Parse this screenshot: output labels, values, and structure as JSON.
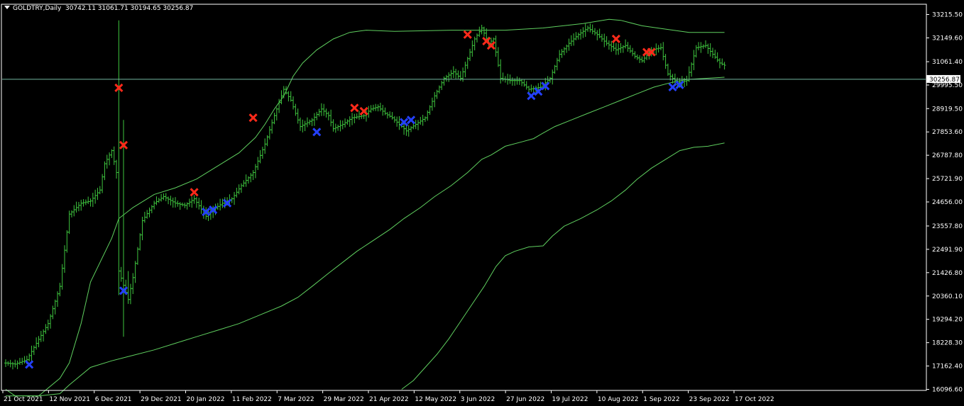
{
  "header": {
    "symbol": "GOLDTRY,Daily",
    "ohlc": "30742.11 31061.71 30194.65 30256.87"
  },
  "colors": {
    "background": "#000000",
    "frame": "#ffffff",
    "bars": "#3ec43e",
    "bands": "#5fcf5f",
    "price_line": "#74b8a0",
    "sell_marker": "#ff2a1a",
    "buy_marker": "#2440ff",
    "price_label_bg": "#ffffff"
  },
  "chart_data": {
    "type": "line",
    "chart_kind": "OHLC bar chart with bands and signal markers",
    "symbol": "GOLDTRY",
    "timeframe": "Daily",
    "current_price": "30256.87",
    "ylim": [
      16096.6,
      33647
    ],
    "y_ticks": [
      "33215.50",
      "32149.60",
      "31061.40",
      "29995.50",
      "28919.50",
      "27853.60",
      "26787.80",
      "25721.90",
      "24656.00",
      "23557.80",
      "22491.90",
      "21426.80",
      "20360.10",
      "19294.20",
      "18228.30",
      "17162.40",
      "16096.60"
    ],
    "x_ticks": [
      "21 Oct 2021",
      "12 Nov 2021",
      "6 Dec 2021",
      "29 Dec 2021",
      "20 Jan 2022",
      "11 Feb 2022",
      "7 Mar 2022",
      "29 Mar 2022",
      "21 Apr 2022",
      "12 May 2022",
      "3 Jun 2022",
      "27 Jun 2022",
      "19 Jul 2022",
      "10 Aug 2022",
      "1 Sep 2022",
      "23 Sep 2022",
      "17 Oct 2022"
    ],
    "close_series": [
      [
        0,
        17300
      ],
      [
        4,
        17250
      ],
      [
        9,
        17450
      ],
      [
        13,
        18200
      ],
      [
        18,
        19100
      ],
      [
        23,
        20800
      ],
      [
        27,
        24100
      ],
      [
        32,
        24600
      ],
      [
        36,
        24700
      ],
      [
        40,
        25200
      ],
      [
        42,
        26400
      ],
      [
        45,
        27000
      ],
      [
        47,
        26000
      ],
      [
        48,
        21500
      ],
      [
        52,
        20200
      ],
      [
        54,
        21200
      ],
      [
        58,
        23800
      ],
      [
        63,
        24600
      ],
      [
        67,
        24900
      ],
      [
        72,
        24600
      ],
      [
        76,
        24500
      ],
      [
        80,
        24800
      ],
      [
        85,
        24000
      ],
      [
        88,
        24300
      ],
      [
        92,
        24600
      ],
      [
        96,
        24800
      ],
      [
        100,
        25400
      ],
      [
        105,
        26000
      ],
      [
        110,
        27300
      ],
      [
        114,
        28600
      ],
      [
        118,
        29800
      ],
      [
        121,
        29300
      ],
      [
        125,
        28100
      ],
      [
        130,
        28400
      ],
      [
        134,
        28900
      ],
      [
        137,
        28600
      ],
      [
        139,
        28000
      ],
      [
        143,
        28200
      ],
      [
        147,
        28500
      ],
      [
        152,
        28600
      ],
      [
        155,
        28900
      ],
      [
        158,
        29000
      ],
      [
        161,
        28700
      ],
      [
        164,
        28500
      ],
      [
        167,
        28200
      ],
      [
        170,
        27900
      ],
      [
        174,
        28200
      ],
      [
        178,
        28500
      ],
      [
        182,
        29500
      ],
      [
        186,
        30300
      ],
      [
        190,
        30600
      ],
      [
        193,
        30300
      ],
      [
        196,
        31200
      ],
      [
        199,
        32100
      ],
      [
        202,
        32600
      ],
      [
        205,
        31900
      ],
      [
        207,
        32100
      ],
      [
        210,
        30300
      ],
      [
        214,
        30200
      ],
      [
        218,
        30200
      ],
      [
        222,
        29800
      ],
      [
        227,
        29900
      ],
      [
        231,
        30300
      ],
      [
        235,
        31400
      ],
      [
        239,
        31900
      ],
      [
        243,
        32300
      ],
      [
        247,
        32600
      ],
      [
        251,
        32300
      ],
      [
        255,
        31900
      ],
      [
        259,
        31600
      ],
      [
        263,
        31800
      ],
      [
        267,
        31300
      ],
      [
        270,
        31100
      ],
      [
        274,
        31600
      ],
      [
        278,
        31700
      ],
      [
        281,
        30500
      ],
      [
        285,
        30100
      ],
      [
        289,
        30200
      ],
      [
        293,
        31700
      ],
      [
        297,
        31800
      ],
      [
        300,
        31400
      ],
      [
        303,
        31000
      ],
      [
        305,
        30900
      ]
    ],
    "upper_band": [
      [
        0,
        16096.6
      ],
      [
        4,
        15800
      ],
      [
        14,
        15800
      ],
      [
        23,
        15900
      ],
      [
        27,
        16300
      ],
      [
        36,
        17100
      ],
      [
        45,
        17400
      ],
      [
        54,
        17650
      ],
      [
        63,
        17900
      ],
      [
        72,
        18200
      ],
      [
        81,
        18500
      ],
      [
        90,
        18800
      ],
      [
        99,
        19100
      ],
      [
        108,
        19500
      ],
      [
        117,
        19900
      ],
      [
        124,
        20300
      ],
      [
        130,
        20800
      ],
      [
        137,
        21400
      ],
      [
        143,
        21900
      ],
      [
        149,
        22400
      ],
      [
        156,
        22900
      ],
      [
        163,
        23400
      ],
      [
        169,
        23900
      ],
      [
        176,
        24400
      ],
      [
        182,
        24900
      ],
      [
        189,
        25400
      ],
      [
        196,
        26000
      ],
      [
        202,
        26600
      ],
      [
        206,
        26800
      ],
      [
        212,
        27200
      ],
      [
        219,
        27400
      ],
      [
        224,
        27550
      ],
      [
        228,
        27800
      ],
      [
        233,
        28100
      ],
      [
        240,
        28400
      ],
      [
        247,
        28700
      ],
      [
        254,
        29000
      ],
      [
        261,
        29300
      ],
      [
        268,
        29600
      ],
      [
        275,
        29900
      ],
      [
        282,
        30100
      ],
      [
        289,
        30250
      ],
      [
        305,
        30350
      ]
    ],
    "middle_band": [
      [
        0,
        15800
      ],
      [
        14,
        15800
      ],
      [
        23,
        16600
      ],
      [
        27,
        17300
      ],
      [
        32,
        19100
      ],
      [
        36,
        21000
      ],
      [
        45,
        23000
      ],
      [
        48,
        23900
      ],
      [
        54,
        24400
      ],
      [
        63,
        25000
      ],
      [
        72,
        25300
      ],
      [
        81,
        25700
      ],
      [
        90,
        26300
      ],
      [
        99,
        26900
      ],
      [
        106,
        27600
      ],
      [
        110,
        28200
      ],
      [
        114,
        28900
      ],
      [
        118,
        29500
      ],
      [
        122,
        30400
      ],
      [
        126,
        31000
      ],
      [
        132,
        31600
      ],
      [
        139,
        32100
      ],
      [
        146,
        32400
      ],
      [
        153,
        32500
      ],
      [
        165,
        32450
      ],
      [
        190,
        32500
      ],
      [
        212,
        32500
      ],
      [
        228,
        32600
      ],
      [
        245,
        32800
      ],
      [
        256,
        33000
      ],
      [
        261,
        32950
      ],
      [
        270,
        32700
      ],
      [
        280,
        32550
      ],
      [
        290,
        32400
      ],
      [
        298,
        32400
      ],
      [
        305,
        32400
      ]
    ],
    "lower_band": [
      [
        168,
        16096.6
      ],
      [
        173,
        16500
      ],
      [
        178,
        17100
      ],
      [
        183,
        17700
      ],
      [
        188,
        18400
      ],
      [
        193,
        19200
      ],
      [
        198,
        20000
      ],
      [
        203,
        20800
      ],
      [
        208,
        21700
      ],
      [
        212,
        22200
      ],
      [
        216,
        22400
      ],
      [
        222,
        22600
      ],
      [
        228,
        22650
      ],
      [
        232,
        23100
      ],
      [
        237,
        23550
      ],
      [
        244,
        23900
      ],
      [
        251,
        24300
      ],
      [
        257,
        24700
      ],
      [
        263,
        25200
      ],
      [
        268,
        25700
      ],
      [
        274,
        26200
      ],
      [
        280,
        26600
      ],
      [
        286,
        27000
      ],
      [
        292,
        27150
      ],
      [
        298,
        27200
      ],
      [
        305,
        27350
      ]
    ],
    "sell_signals": [
      [
        48,
        29870
      ],
      [
        50,
        27250
      ],
      [
        80,
        25100
      ],
      [
        105,
        28500
      ],
      [
        148,
        28950
      ],
      [
        152,
        28800
      ],
      [
        196,
        32300
      ],
      [
        204,
        32000
      ],
      [
        206,
        31800
      ],
      [
        259,
        32100
      ],
      [
        272,
        31500
      ],
      [
        274,
        31500
      ]
    ],
    "buy_signals": [
      [
        10,
        17230
      ],
      [
        50,
        20600
      ],
      [
        85,
        24200
      ],
      [
        88,
        24300
      ],
      [
        94,
        24600
      ],
      [
        132,
        27850
      ],
      [
        169,
        28300
      ],
      [
        172,
        28400
      ],
      [
        223,
        29500
      ],
      [
        226,
        29700
      ],
      [
        229,
        29950
      ],
      [
        283,
        29900
      ],
      [
        286,
        30000
      ]
    ]
  }
}
